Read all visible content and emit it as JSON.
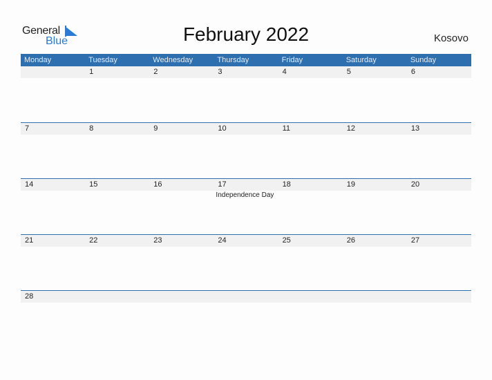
{
  "logo": {
    "line1": "General",
    "line2": "Blue"
  },
  "title": "February 2022",
  "country": "Kosovo",
  "weekdays": [
    "Monday",
    "Tuesday",
    "Wednesday",
    "Thursday",
    "Friday",
    "Saturday",
    "Sunday"
  ],
  "weeks": [
    {
      "days": [
        "",
        "1",
        "2",
        "3",
        "4",
        "5",
        "6"
      ],
      "holidays": [
        "",
        "",
        "",
        "",
        "",
        "",
        ""
      ]
    },
    {
      "days": [
        "7",
        "8",
        "9",
        "10",
        "11",
        "12",
        "13"
      ],
      "holidays": [
        "",
        "",
        "",
        "",
        "",
        "",
        ""
      ]
    },
    {
      "days": [
        "14",
        "15",
        "16",
        "17",
        "18",
        "19",
        "20"
      ],
      "holidays": [
        "",
        "",
        "",
        "Independence Day",
        "",
        "",
        ""
      ]
    },
    {
      "days": [
        "21",
        "22",
        "23",
        "24",
        "25",
        "26",
        "27"
      ],
      "holidays": [
        "",
        "",
        "",
        "",
        "",
        "",
        ""
      ]
    },
    {
      "days": [
        "28"
      ],
      "holidays": [
        ""
      ],
      "partial": true
    }
  ],
  "colors": {
    "header_bg": "#2e6fb0",
    "brand_blue": "#2a7bd1",
    "date_strip_bg": "#f1f1f1"
  }
}
